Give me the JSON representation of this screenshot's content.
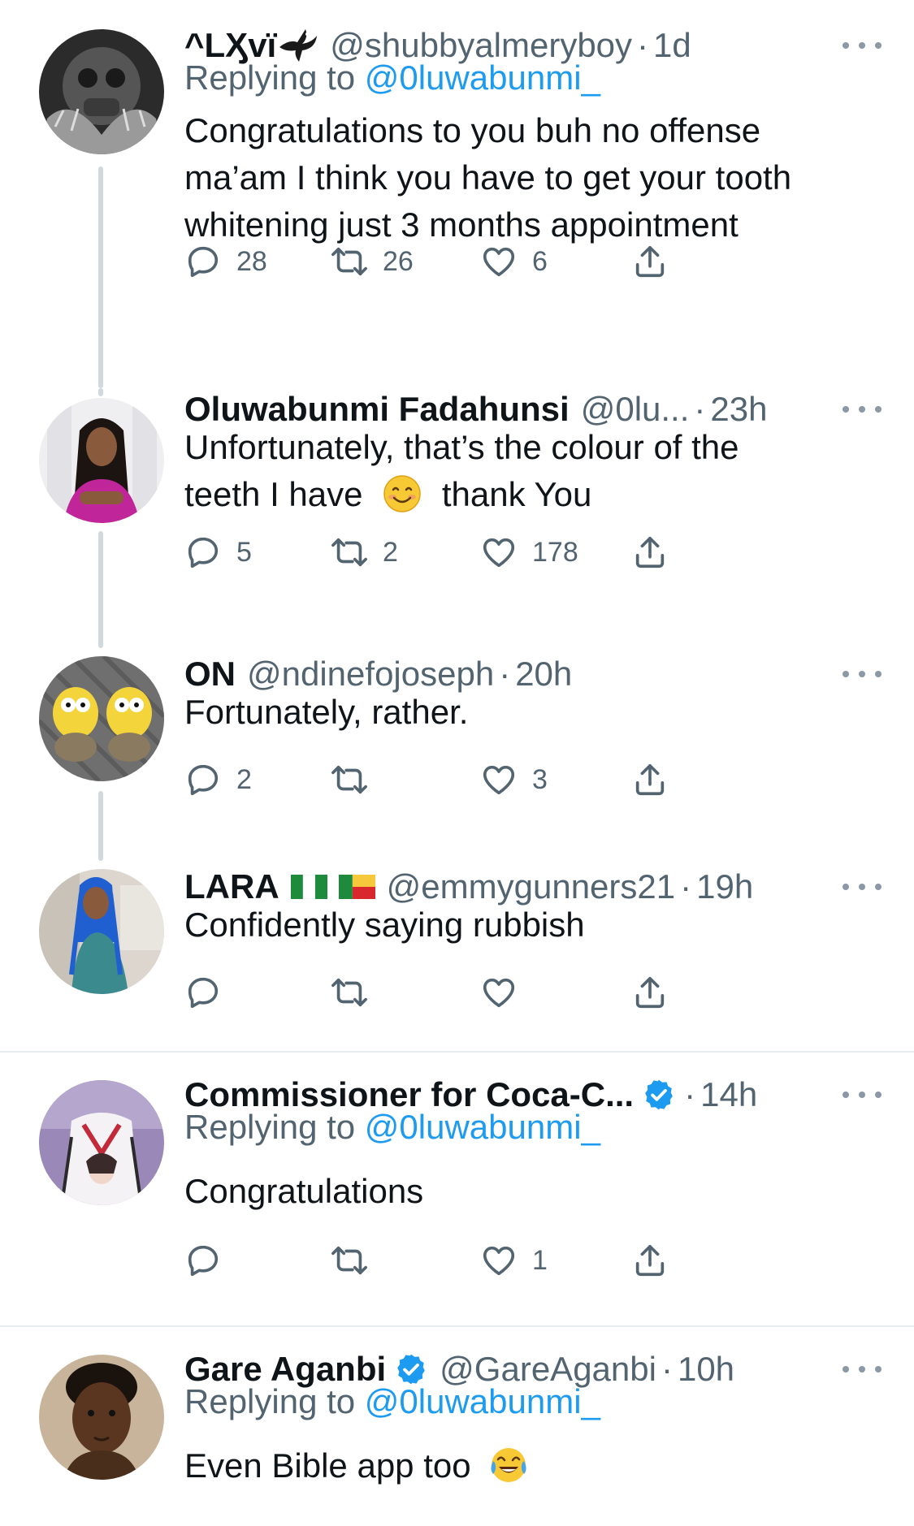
{
  "tweets": [
    {
      "name": "^LӼvï",
      "handle": "@shubbyalmeryboy",
      "dot": "·",
      "time": "1d",
      "replying_prefix": "Replying to ",
      "replying_handle": "@0luwabunmi_",
      "body_lines": [
        "Congratulations to you buh no offense",
        "ma’am I think you have to get your tooth",
        "whitening just 3 months appointment"
      ],
      "replies": "28",
      "retweets": "26",
      "likes": "6"
    },
    {
      "name": "Oluwabunmi Fadahunsi",
      "handle": "@0lu...",
      "dot": "·",
      "time": "23h",
      "body_line1": "Unfortunately, that’s the colour of the",
      "body_line2a": "teeth I have",
      "body_line2b": "thank You",
      "replies": "5",
      "retweets": "2",
      "likes": "178"
    },
    {
      "name": "ON",
      "handle": "@ndinefojoseph",
      "dot": "·",
      "time": "20h",
      "body": "Fortunately, rather.",
      "replies": "2",
      "retweets": "",
      "likes": "3"
    },
    {
      "name": "LARA",
      "handle": "@emmygunners21",
      "dot": "·",
      "time": "19h",
      "body": "Confidently saying rubbish",
      "replies": "",
      "retweets": "",
      "likes": ""
    },
    {
      "name": "Commissioner for Coca-C...",
      "dot": "·",
      "time": "14h",
      "replying_prefix": "Replying to ",
      "replying_handle": "@0luwabunmi_",
      "body": "Congratulations",
      "replies": "",
      "retweets": "",
      "likes": "1"
    },
    {
      "name": "Gare Aganbi",
      "handle": "@GareAganbi",
      "dot": "·",
      "time": "10h",
      "replying_prefix": "Replying to ",
      "replying_handle": "@0luwabunmi_",
      "body": "Even Bible app too"
    }
  ],
  "icons": {
    "reply": "reply-icon",
    "retweet": "retweet-icon",
    "like": "heart-icon",
    "share": "share-icon",
    "more": "more-icon",
    "verified": "verified-badge-icon"
  },
  "colors": {
    "link": "#1d9bf0",
    "secondary_text": "#536471",
    "thread_line": "#cfd9de",
    "verified": "#1d9bf0"
  }
}
